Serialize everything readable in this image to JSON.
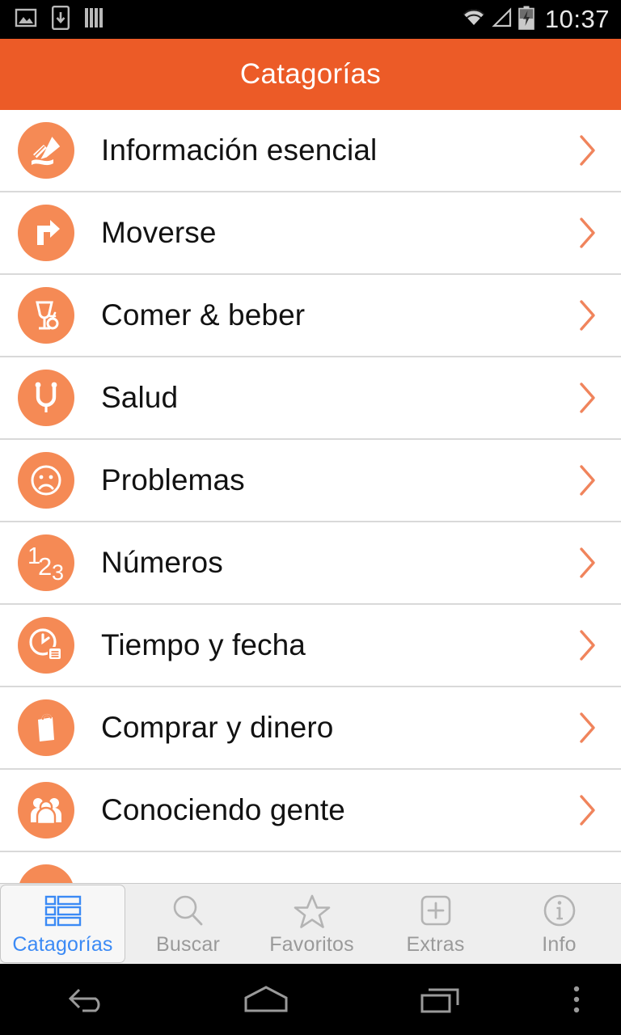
{
  "status_bar": {
    "time": "10:37",
    "left_icons": [
      "image-icon",
      "download-to-device-icon",
      "bars-icon"
    ],
    "right_icons": [
      "wifi-icon",
      "cellular-signal-icon",
      "battery-charging-icon"
    ],
    "background_color": "#000000",
    "text_color": "#e8e8e8"
  },
  "app_bar": {
    "title": "Catagorías",
    "background_color": "#ec5b27",
    "text_color": "#ffffff"
  },
  "theme": {
    "accent_orange": "#ec5b27",
    "icon_circle_orange": "#f58a55",
    "chevron_orange": "#f0845c",
    "active_tab_blue": "#3b8af5",
    "inactive_tab_gray": "#9a9a9a",
    "divider_gray": "#d9d9d9",
    "tabbar_background": "#eeeeee"
  },
  "categories": [
    {
      "label": "Información esencial",
      "icon": "pencil-writing-icon",
      "chevron": "chevron-right-icon"
    },
    {
      "label": "Moverse",
      "icon": "turn-right-arrow-icon",
      "chevron": "chevron-right-icon"
    },
    {
      "label": "Comer & beber",
      "icon": "wine-glass-fork-icon",
      "chevron": "chevron-right-icon"
    },
    {
      "label": "Salud",
      "icon": "stethoscope-icon",
      "chevron": "chevron-right-icon"
    },
    {
      "label": "Problemas",
      "icon": "sad-face-icon",
      "chevron": "chevron-right-icon"
    },
    {
      "label": "Números",
      "icon": "numbers-123-icon",
      "chevron": "chevron-right-icon"
    },
    {
      "label": "Tiempo y fecha",
      "icon": "clock-calendar-icon",
      "chevron": "chevron-right-icon"
    },
    {
      "label": "Comprar y dinero",
      "icon": "shopping-bag-icon",
      "chevron": "chevron-right-icon"
    },
    {
      "label": "Conociendo gente",
      "icon": "people-group-icon",
      "chevron": "chevron-right-icon"
    },
    {
      "label": "",
      "icon": "partial-row-icon",
      "chevron": ""
    }
  ],
  "tab_bar": {
    "items": [
      {
        "label": "Catagorías",
        "icon": "list-grid-icon",
        "active": true
      },
      {
        "label": "Buscar",
        "icon": "magnifier-icon",
        "active": false
      },
      {
        "label": "Favoritos",
        "icon": "star-outline-icon",
        "active": false
      },
      {
        "label": "Extras",
        "icon": "plus-square-icon",
        "active": false
      },
      {
        "label": "Info",
        "icon": "info-circle-icon",
        "active": false
      }
    ]
  },
  "nav_bar": {
    "buttons": [
      {
        "name": "back-icon"
      },
      {
        "name": "home-icon"
      },
      {
        "name": "recents-icon"
      },
      {
        "name": "overflow-menu-icon"
      }
    ]
  }
}
